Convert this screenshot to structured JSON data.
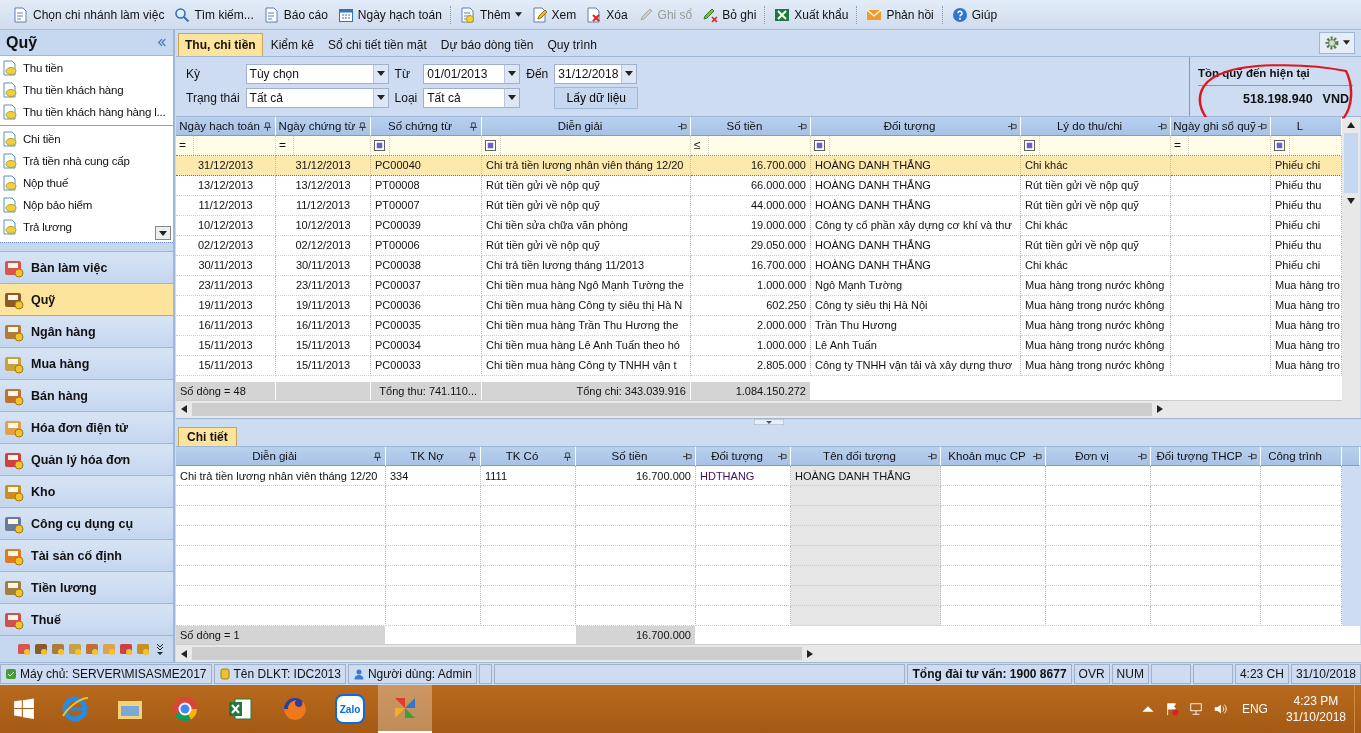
{
  "toolbar": [
    {
      "label": "Chọn chi nhánh làm việc",
      "disabled": false
    },
    {
      "label": "Tìm kiếm...",
      "disabled": false
    },
    {
      "label": "Báo cáo",
      "disabled": false
    },
    {
      "label": "Ngày hạch toán",
      "disabled": false
    },
    {
      "label": "Thêm",
      "disabled": false,
      "dropdown": true
    },
    {
      "label": "Xem",
      "disabled": false
    },
    {
      "label": "Xóa",
      "disabled": false
    },
    {
      "label": "Ghi sổ",
      "disabled": true
    },
    {
      "label": "Bỏ ghi",
      "disabled": false
    },
    {
      "label": "Xuất khẩu",
      "disabled": false
    },
    {
      "label": "Phản hồi",
      "disabled": false
    },
    {
      "label": "Giúp",
      "disabled": false
    }
  ],
  "sidebar": {
    "title": "Quỹ",
    "groups": [
      [
        "Thu tiền",
        "Thu tiền khách hàng",
        "Thu tiền khách hàng hàng l..."
      ],
      [
        "Chi tiền",
        "Trả tiền nhà cung cấp",
        "Nộp thuế",
        "Nộp bảo hiểm",
        "Trả lương"
      ]
    ],
    "modules": [
      {
        "label": "Bàn làm việc",
        "selected": false
      },
      {
        "label": "Quỹ",
        "selected": true
      },
      {
        "label": "Ngân hàng",
        "selected": false
      },
      {
        "label": "Mua hàng",
        "selected": false
      },
      {
        "label": "Bán hàng",
        "selected": false
      },
      {
        "label": "Hóa đơn điện tử",
        "selected": false
      },
      {
        "label": "Quản lý hóa đơn",
        "selected": false
      },
      {
        "label": "Kho",
        "selected": false
      },
      {
        "label": "Công cụ dụng cụ",
        "selected": false
      },
      {
        "label": "Tài sản cố định",
        "selected": false
      },
      {
        "label": "Tiền lương",
        "selected": false
      },
      {
        "label": "Thuế",
        "selected": false
      }
    ]
  },
  "tabs": [
    {
      "label": "Thu, chi tiền",
      "selected": true
    },
    {
      "label": "Kiểm kê",
      "selected": false
    },
    {
      "label": "Sổ chi tiết tiền mặt",
      "selected": false
    },
    {
      "label": "Dự báo dòng tiền",
      "selected": false
    },
    {
      "label": "Quy trình",
      "selected": false
    }
  ],
  "filters": {
    "period": {
      "label": "Kỳ",
      "value": "Tùy chọn"
    },
    "from": {
      "label": "Từ",
      "value": "01/01/2013"
    },
    "to": {
      "label": "Đến",
      "value": "31/12/2018"
    },
    "status": {
      "label": "Trạng thái",
      "value": "Tất cả"
    },
    "type": {
      "label": "Loại",
      "value": "Tất cả"
    },
    "button": "Lấy dữ liệu"
  },
  "balance": {
    "title": "Tồn quỹ đến hiện tại",
    "amount": "518.198.940",
    "currency": "VND"
  },
  "table": {
    "columns": [
      {
        "label": "Ngày hạch toán",
        "pinned": true,
        "filter": {
          "kind": "operator",
          "text": "="
        }
      },
      {
        "label": "Ngày chứng từ",
        "pinned": true,
        "filter": {
          "kind": "operator",
          "text": "="
        }
      },
      {
        "label": "Số chứng từ",
        "pinned": true,
        "filter": {
          "kind": "checkbox"
        }
      },
      {
        "label": "Diễn giải",
        "pinned": false,
        "filter": {
          "kind": "checkbox"
        }
      },
      {
        "label": "Số tiền",
        "pinned": false,
        "filter": {
          "kind": "operator",
          "text": "≤"
        }
      },
      {
        "label": "Đối tượng",
        "pinned": false,
        "filter": {
          "kind": "checkbox"
        }
      },
      {
        "label": "Lý do thu/chi",
        "pinned": false,
        "filter": {
          "kind": "checkbox"
        }
      },
      {
        "label": "Ngày ghi sổ quỹ",
        "pinned": false,
        "filter": {
          "kind": "operator",
          "text": "="
        }
      },
      {
        "label": "L",
        "filter": {
          "kind": "checkbox"
        }
      }
    ],
    "rows": [
      {
        "selected": true,
        "accounting_date": "31/12/2013",
        "voucher_date": "31/12/2013",
        "voucher_no": "PC00040",
        "description": "Chi trả tiền lương nhân viên tháng 12/20",
        "amount": "16.700.000",
        "subject": "HOÀNG DANH THẮNG",
        "reason": "Chi khác",
        "voucher_type": "Phiếu chi"
      },
      {
        "selected": false,
        "accounting_date": "13/12/2013",
        "voucher_date": "13/12/2013",
        "voucher_no": "PT00008",
        "description": "Rút tiền gửi về nộp quỹ",
        "amount": "66.000.000",
        "subject": "HOÀNG DANH THẮNG",
        "reason": "Rút tiền gửi về nộp quỹ",
        "voucher_type": "Phiếu thu"
      },
      {
        "selected": false,
        "accounting_date": "11/12/2013",
        "voucher_date": "11/12/2013",
        "voucher_no": "PT00007",
        "description": "Rút tiền gửi về nộp quỹ",
        "amount": "44.000.000",
        "subject": "HOÀNG DANH THẮNG",
        "reason": "Rút tiền gửi về nộp quỹ",
        "voucher_type": "Phiếu thu"
      },
      {
        "selected": false,
        "accounting_date": "10/12/2013",
        "voucher_date": "10/12/2013",
        "voucher_no": "PC00039",
        "description": "Chi tiền sửa chữa văn phòng",
        "amount": "19.000.000",
        "subject": "Công ty cổ phần xây dựng cơ khí và thư",
        "reason": "Chi khác",
        "voucher_type": "Phiếu chi"
      },
      {
        "selected": false,
        "accounting_date": "02/12/2013",
        "voucher_date": "02/12/2013",
        "voucher_no": "PT00006",
        "description": "Rút tiền gửi về nộp quỹ",
        "amount": "29.050.000",
        "subject": "HOÀNG DANH THẮNG",
        "reason": "Rút tiền gửi về nộp quỹ",
        "voucher_type": "Phiếu thu"
      },
      {
        "selected": false,
        "accounting_date": "30/11/2013",
        "voucher_date": "30/11/2013",
        "voucher_no": "PC00038",
        "description": "Chi trả tiền lương tháng 11/2013",
        "amount": "16.700.000",
        "subject": "HOÀNG DANH THẮNG",
        "reason": "Chi khác",
        "voucher_type": "Phiếu chi"
      },
      {
        "selected": false,
        "accounting_date": "23/11/2013",
        "voucher_date": "23/11/2013",
        "voucher_no": "PC00037",
        "description": "Chi tiền mua hàng Ngô Mạnh Tường the",
        "amount": "1.000.000",
        "subject": "Ngô Mạnh Tường",
        "reason": "Mua hàng trong nước không",
        "voucher_type": "Mua hàng tro"
      },
      {
        "selected": false,
        "accounting_date": "19/11/2013",
        "voucher_date": "19/11/2013",
        "voucher_no": "PC00036",
        "description": "Chi tiền mua hàng Công ty siêu thị Hà N",
        "amount": "602.250",
        "subject": "Công ty siêu thị Hà Nội",
        "reason": "Mua hàng trong nước không",
        "voucher_type": "Mua hàng tro"
      },
      {
        "selected": false,
        "accounting_date": "16/11/2013",
        "voucher_date": "16/11/2013",
        "voucher_no": "PC00035",
        "description": "Chi tiền mua hàng Trần Thu Hương the",
        "amount": "2.000.000",
        "subject": "Trần Thu Hương",
        "reason": "Mua hàng trong nước không",
        "voucher_type": "Mua hàng tro"
      },
      {
        "selected": false,
        "accounting_date": "15/11/2013",
        "voucher_date": "15/11/2013",
        "voucher_no": "PC00034",
        "description": "Chi tiền mua hàng Lê Anh Tuấn theo hó",
        "amount": "1.000.000",
        "subject": "Lê Anh Tuấn",
        "reason": "Mua hàng trong nước không",
        "voucher_type": "Mua hàng tro"
      },
      {
        "selected": false,
        "accounting_date": "15/11/2013",
        "voucher_date": "15/11/2013",
        "voucher_no": "PC00033",
        "description": "Chi tiền mua hàng Công ty TNHH vận t",
        "amount": "2.805.000",
        "subject": "Công ty TNHH vận tải và xây dựng thươ",
        "reason": "Mua hàng trong nước không",
        "voucher_type": "Mua hàng tro"
      }
    ],
    "footer": [
      "Số dòng = 48",
      "Tổng thu: 741.110...",
      "Tổng chi: 343.039.916",
      "1.084.150.272"
    ]
  },
  "detail": {
    "tab": "Chi tiết",
    "columns": [
      {
        "label": "Diễn giải",
        "pinned": true,
        "readonly": false
      },
      {
        "label": "TK Nợ",
        "pinned": true,
        "readonly": false
      },
      {
        "label": "TK Có",
        "pinned": true,
        "readonly": false
      },
      {
        "label": "Số tiền",
        "pinned": false,
        "readonly": false
      },
      {
        "label": "Đối tượng",
        "pinned": false,
        "readonly": false
      },
      {
        "label": "Tên đối tượng",
        "pinned": false,
        "readonly": true
      },
      {
        "label": "Khoản mục CP",
        "pinned": false,
        "readonly": false
      },
      {
        "label": "Đơn vị",
        "pinned": false,
        "readonly": false
      },
      {
        "label": "Đối tượng THCP",
        "pinned": false,
        "readonly": false
      },
      {
        "label": "Công trình",
        "readonly": false
      }
    ],
    "rows": [
      {
        "description": "Chi trả tiền lương nhân viên tháng 12/20",
        "debit": "334",
        "credit": "1111",
        "amount": "16.700.000",
        "subject_code": "HDTHANG",
        "subject_name": "HOÀNG DANH THẮNG"
      }
    ],
    "footer": [
      "Số dòng = 1",
      "16.700.000"
    ]
  },
  "status_bar": [
    {
      "text": "Máy chủ: SERVER\\MISASME2017",
      "bold": false
    },
    {
      "text": "Tên DLKT: IDC2013",
      "bold": false
    },
    {
      "text": "Người dùng: Admin",
      "bold": false
    },
    {
      "text": "Tổng đài tư vấn: 1900 8677",
      "bold": true
    },
    {
      "text": "OVR",
      "bold": false
    },
    {
      "text": "NUM",
      "bold": false
    },
    {
      "text": "4:23 CH",
      "bold": false
    },
    {
      "text": "31/10/2018",
      "bold": false
    }
  ],
  "taskbar": {
    "apps": [
      {
        "selected": false
      },
      {
        "selected": false
      },
      {
        "selected": false
      },
      {
        "selected": false
      },
      {
        "selected": false
      },
      {
        "selected": false,
        "label": "Zalo"
      },
      {
        "selected": true
      }
    ],
    "language": "ENG",
    "time": "4:23 PM",
    "date": "31/10/2018"
  }
}
